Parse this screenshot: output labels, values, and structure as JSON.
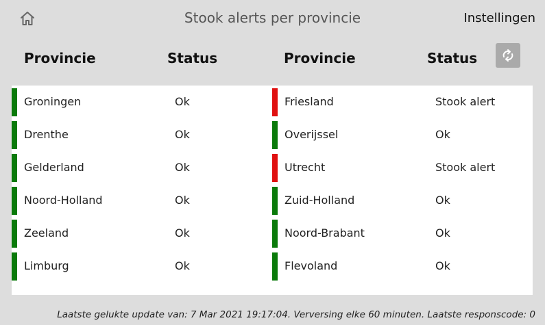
{
  "header": {
    "home_icon": "home-icon",
    "title": "Stook alerts per provincie",
    "settings_label": "Instellingen",
    "refresh_icon": "refresh-icon"
  },
  "columns": {
    "left_province": "Provincie",
    "left_status": "Status",
    "right_province": "Provincie",
    "right_status": "Status"
  },
  "colors": {
    "ok": "#0a7a0a",
    "alert": "#e01010",
    "refresh_button": "#aaaaaa"
  },
  "left": [
    {
      "name": "Groningen",
      "status": "Ok",
      "state": "ok"
    },
    {
      "name": "Drenthe",
      "status": "Ok",
      "state": "ok"
    },
    {
      "name": "Gelderland",
      "status": "Ok",
      "state": "ok"
    },
    {
      "name": "Noord-Holland",
      "status": "Ok",
      "state": "ok"
    },
    {
      "name": "Zeeland",
      "status": "Ok",
      "state": "ok"
    },
    {
      "name": "Limburg",
      "status": "Ok",
      "state": "ok"
    }
  ],
  "right": [
    {
      "name": "Friesland",
      "status": "Stook alert",
      "state": "alert"
    },
    {
      "name": "Overijssel",
      "status": "Ok",
      "state": "ok"
    },
    {
      "name": "Utrecht",
      "status": "Stook alert",
      "state": "alert"
    },
    {
      "name": "Zuid-Holland",
      "status": "Ok",
      "state": "ok"
    },
    {
      "name": "Noord-Brabant",
      "status": "Ok",
      "state": "ok"
    },
    {
      "name": "Flevoland",
      "status": "Ok",
      "state": "ok"
    }
  ],
  "footer": {
    "text": "Laatste gelukte update van: 7 Mar 2021 19:17:04. Verversing elke 60 minuten. Laatste responscode: 0"
  }
}
